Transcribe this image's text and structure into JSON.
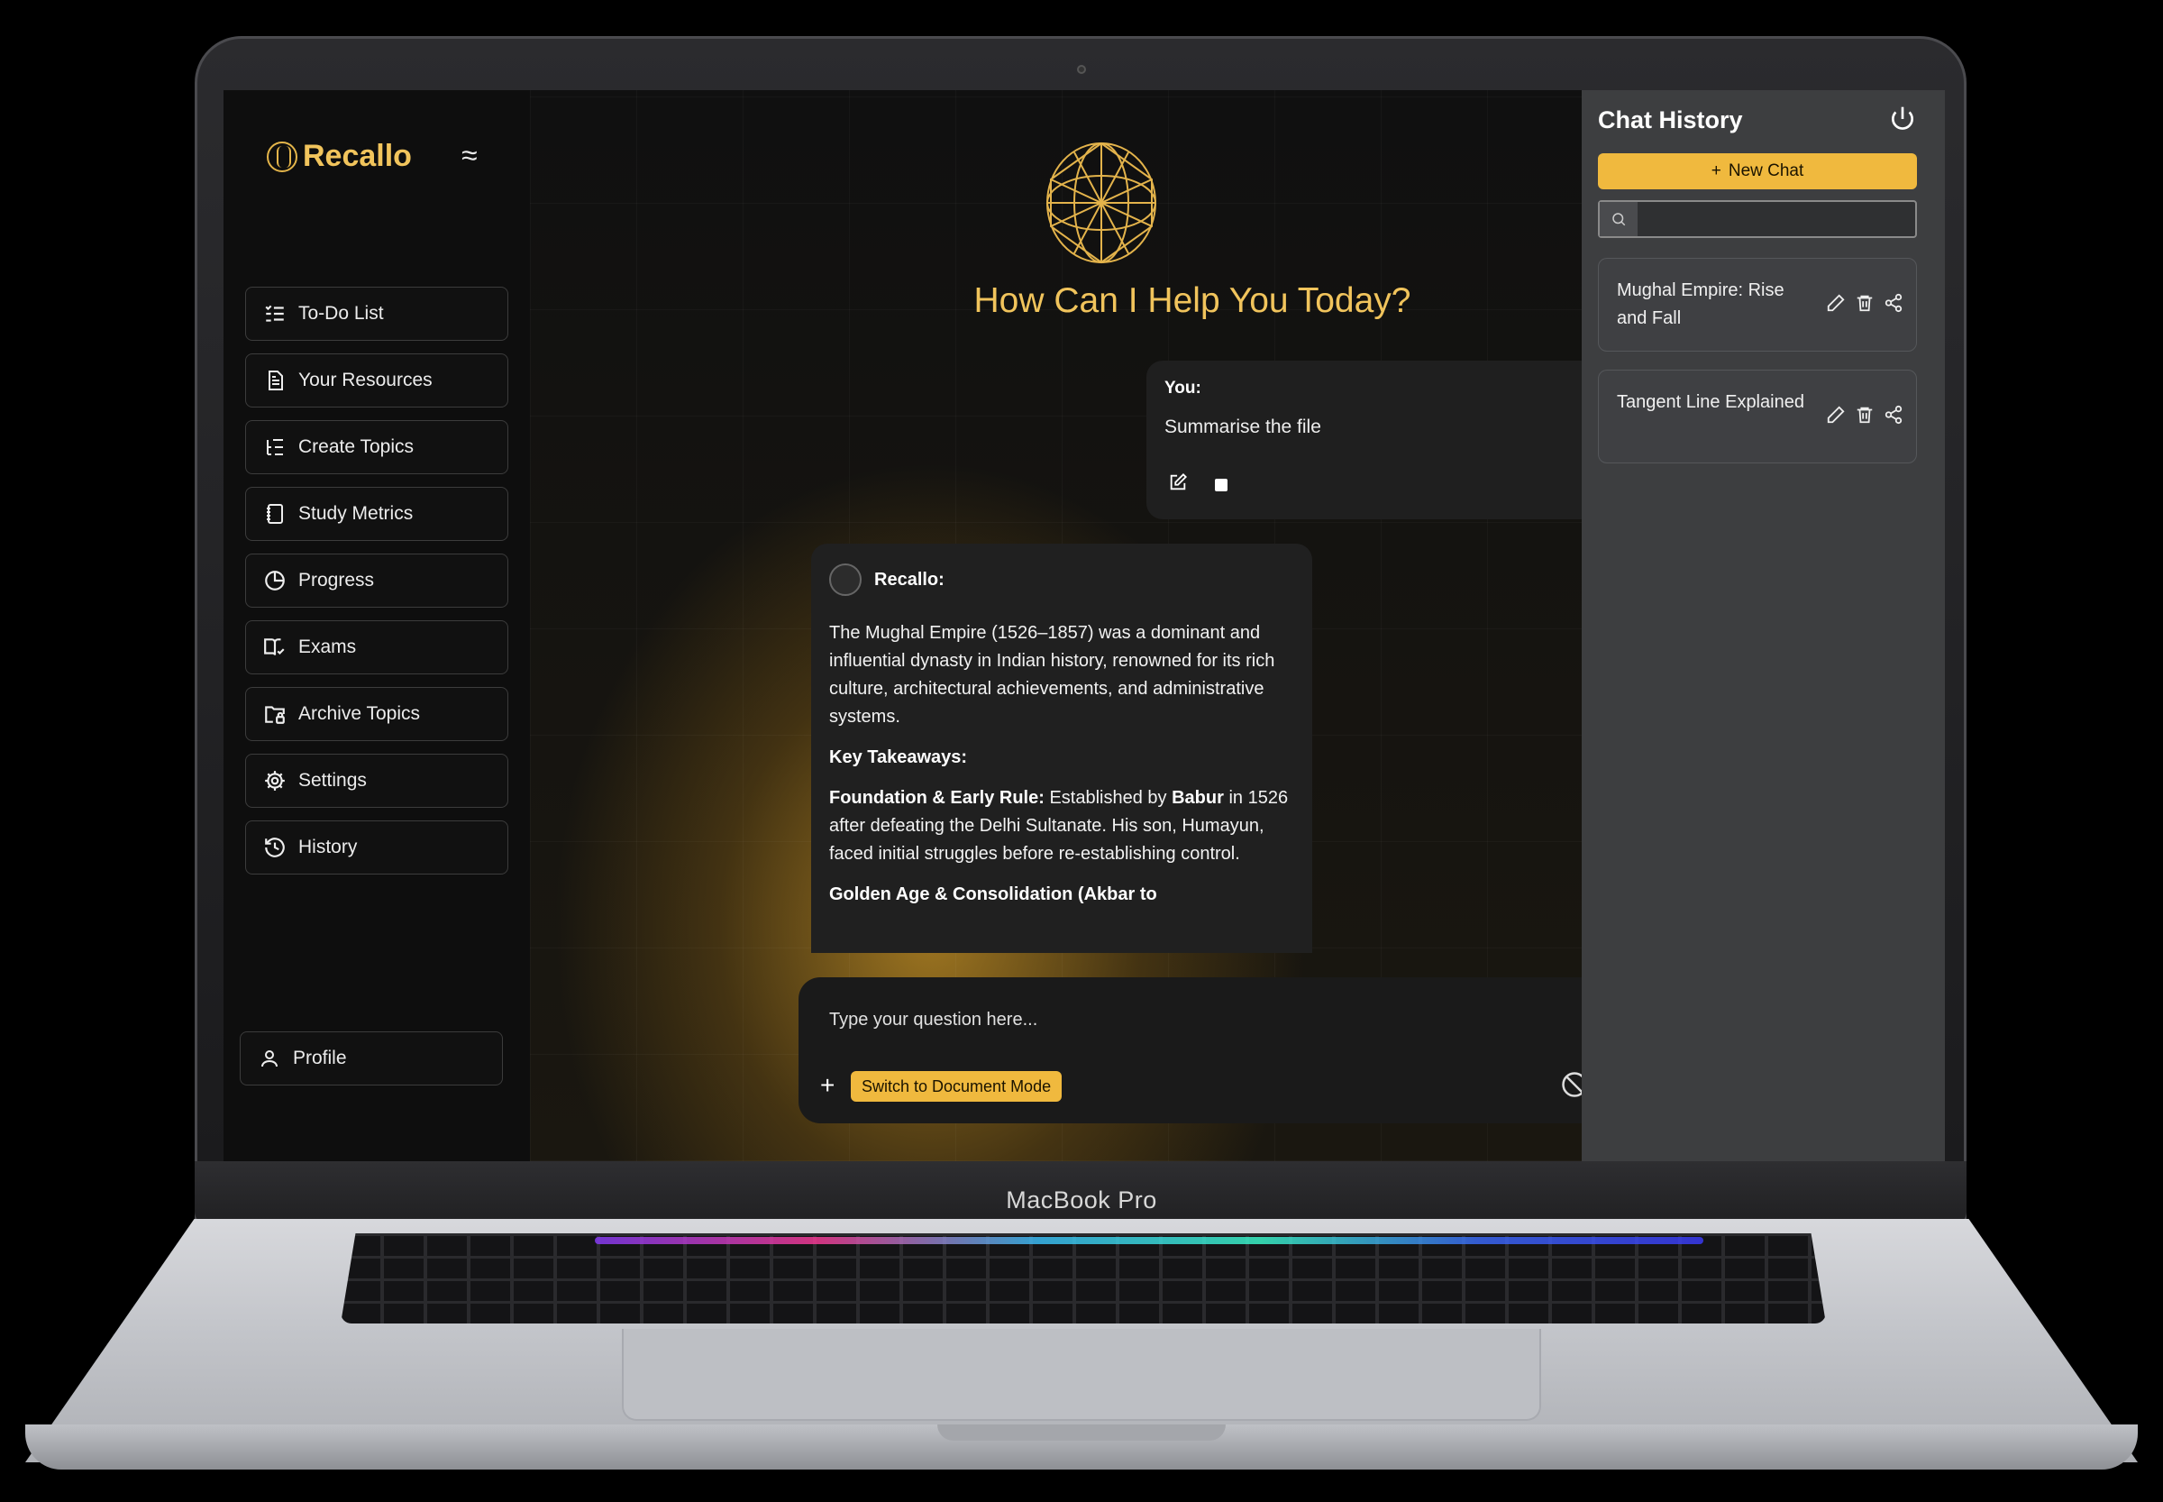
{
  "device": {
    "chin_label": "MacBook Pro"
  },
  "brand": {
    "name": "Recallo"
  },
  "sidebar": {
    "items": [
      {
        "label": "To-Do List",
        "icon": "checklist-icon"
      },
      {
        "label": "Your Resources",
        "icon": "document-icon"
      },
      {
        "label": "Create Topics",
        "icon": "topics-list-icon"
      },
      {
        "label": "Study Metrics",
        "icon": "notebook-icon"
      },
      {
        "label": "Progress",
        "icon": "pie-chart-icon"
      },
      {
        "label": "Exams",
        "icon": "book-check-icon"
      },
      {
        "label": "Archive Topics",
        "icon": "folder-lock-icon"
      },
      {
        "label": "Settings",
        "icon": "gear-icon"
      },
      {
        "label": "History",
        "icon": "history-icon"
      }
    ],
    "profile": {
      "label": "Profile",
      "icon": "user-icon"
    }
  },
  "main": {
    "headline": "How Can I Help You Today?",
    "user_message": {
      "author": "You:",
      "text": "Summarise the file"
    },
    "bot_message": {
      "author": "Recallo:",
      "intro": "The Mughal Empire (1526–1857) was a dominant and influential dynasty in Indian history, renowned for its rich culture, architectural achievements, and administrative systems.",
      "takeaways_heading": "Key Takeaways:",
      "point1_title": "Foundation & Early Rule:",
      "point1_text_a": " Established by ",
      "point1_bold": "Babur",
      "point1_text_b": " in 1526 after defeating the Delhi Sultanate. His son, Humayun, faced initial struggles before re-establishing control.",
      "point2_title": "Golden Age & Consolidation (Akbar to"
    },
    "composer": {
      "placeholder": "Type your question here...",
      "doc_mode_label": "Switch to Document Mode"
    }
  },
  "history": {
    "title": "Chat History",
    "new_chat_label": "New Chat",
    "search_placeholder": "",
    "chats": [
      {
        "title": "Mughal Empire: Rise and Fall"
      },
      {
        "title": "Tangent Line Explained"
      }
    ]
  },
  "colors": {
    "accent": "#f0b93e",
    "brand_text": "#f1c45c",
    "history_bg": "#3d3e40"
  }
}
